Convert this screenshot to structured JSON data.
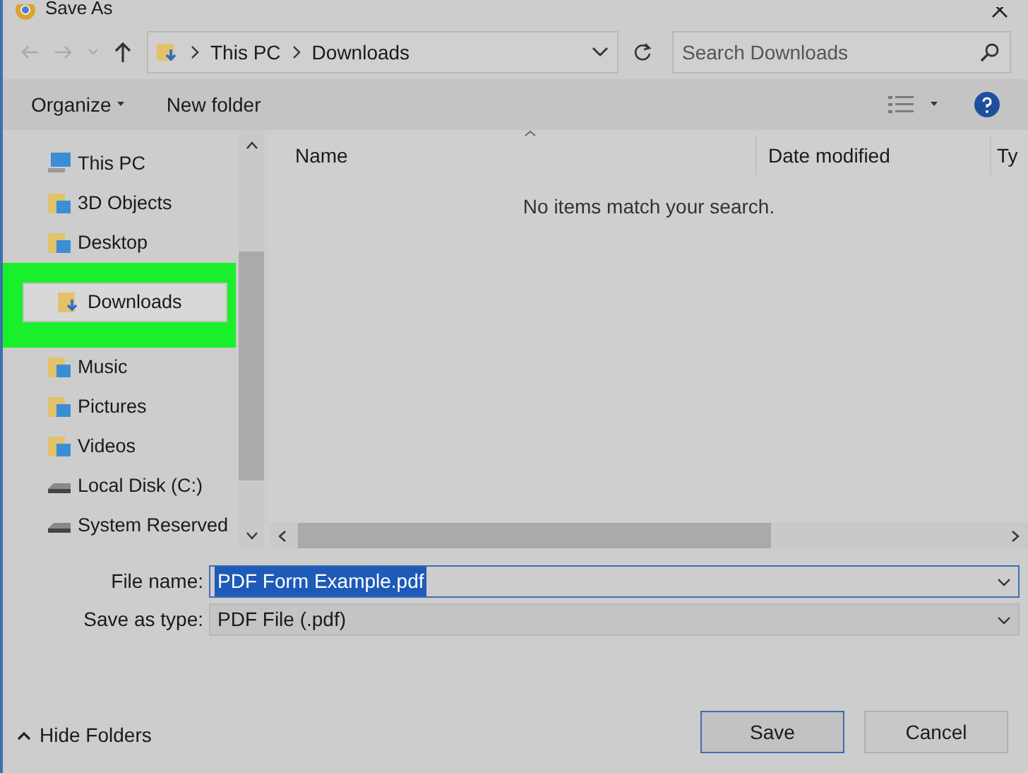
{
  "window": {
    "title": "Save As"
  },
  "path": [
    "This PC",
    "Downloads"
  ],
  "search": {
    "placeholder": "Search Downloads"
  },
  "toolbar": {
    "organize": "Organize",
    "new_folder": "New folder"
  },
  "sidebar": {
    "items": [
      {
        "label": "This PC",
        "kind": "pc",
        "selected": false,
        "children": [
          {
            "label": "3D Objects",
            "kind": "folder",
            "selected": false
          },
          {
            "label": "Desktop",
            "kind": "folder",
            "selected": false
          },
          {
            "label": "Downloads",
            "kind": "download",
            "selected": true,
            "highlighted": true
          },
          {
            "label": "Music",
            "kind": "folder",
            "selected": false
          },
          {
            "label": "Pictures",
            "kind": "folder",
            "selected": false
          },
          {
            "label": "Videos",
            "kind": "folder",
            "selected": false
          },
          {
            "label": "Local Disk (C:)",
            "kind": "drive",
            "selected": false
          },
          {
            "label": "System Reserved",
            "kind": "drive",
            "selected": false
          }
        ]
      }
    ]
  },
  "table": {
    "columns": [
      "Name",
      "Date modified",
      "Ty"
    ],
    "empty_message": "No items match your search."
  },
  "file_name": {
    "label": "File name:",
    "value": "PDF Form Example.pdf",
    "text_selected": true
  },
  "save_as_type": {
    "label": "Save as type:",
    "value": "PDF File (.pdf)"
  },
  "hide_folders": "Hide Folders",
  "buttons": [
    {
      "label": "Save",
      "default": true
    },
    {
      "label": "Cancel",
      "default": false
    }
  ]
}
